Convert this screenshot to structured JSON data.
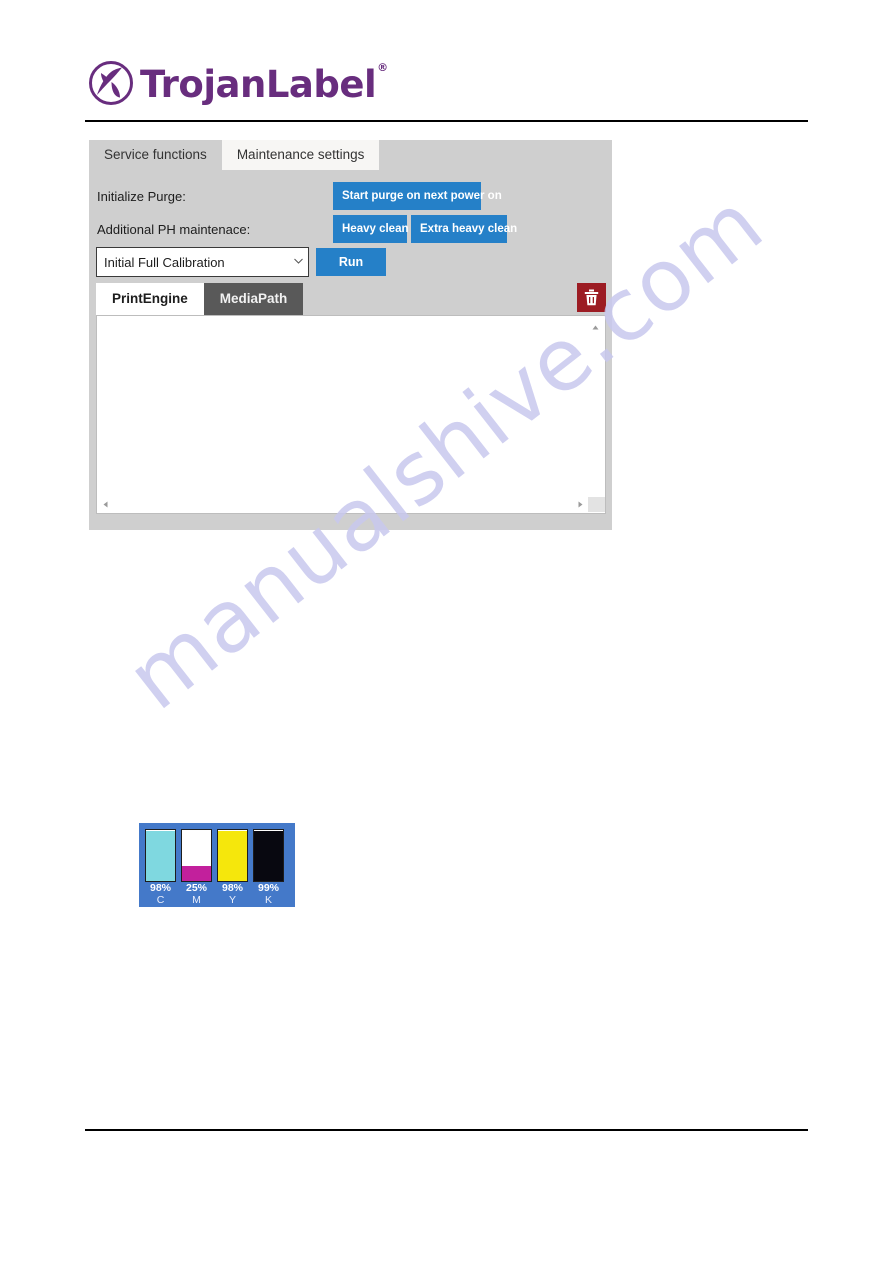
{
  "brand": {
    "name": "TrojanLabel",
    "registered_mark": "®",
    "color": "#682d7e"
  },
  "watermark": {
    "text": "manualshive.com",
    "color": "#c8c8ee"
  },
  "app": {
    "top_tabs": [
      {
        "label": "Service functions",
        "state": "inactive"
      },
      {
        "label": "Maintenance settings",
        "state": "active"
      }
    ],
    "rows": {
      "initialize_purge": {
        "label": "Initialize Purge:",
        "button": "Start purge on next power on"
      },
      "additional_ph_maintenance": {
        "label": "Additional PH maintenace:",
        "buttons": [
          "Heavy clean",
          "Extra heavy clean"
        ]
      },
      "calibration": {
        "selected": "Initial Full Calibration",
        "caret": "▼",
        "run_button": "Run"
      }
    },
    "sub_tabs": [
      {
        "label": "PrintEngine",
        "state": "active"
      },
      {
        "label": "MediaPath",
        "state": "inactive"
      }
    ],
    "delete_button": {
      "icon": "trash-icon",
      "color": "#9c1c23"
    },
    "scrollbar": {
      "up_arrow": "▲",
      "left_arrow": "◀",
      "right_arrow": "▶"
    },
    "accent_color": "#2580c8",
    "panel_color": "#cfcfcf"
  },
  "ink_levels": {
    "background_color": "#4479c9",
    "cartridges": [
      {
        "key": "C",
        "name": "Cyan",
        "percent_label": "98%",
        "percent": 98,
        "color": "#7fd8e0"
      },
      {
        "key": "M",
        "name": "Magenta",
        "percent_label": "25%",
        "percent": 25,
        "color": "#c2209c"
      },
      {
        "key": "Y",
        "name": "Yellow",
        "percent_label": "98%",
        "percent": 98,
        "color": "#f5e70c"
      },
      {
        "key": "K",
        "name": "Black",
        "percent_label": "99%",
        "percent": 99,
        "color": "#080810"
      }
    ]
  }
}
